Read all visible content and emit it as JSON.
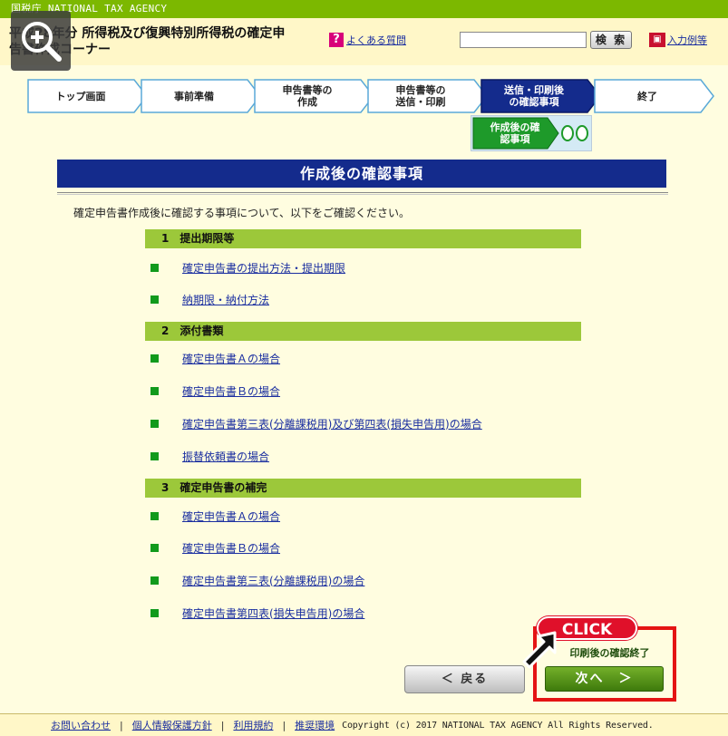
{
  "topbar": {
    "agency": "国税庁 NATIONAL TAX AGENCY"
  },
  "header": {
    "title_line1": "平成28年分 所得税及び復興特別所得税の確定申",
    "title_line2": "告書作成コーナー",
    "faq_icon": "?",
    "faq_label": "よくある質問",
    "search_value": "",
    "search_button": "検 索",
    "examples_icon": "book-icon",
    "examples_label": "入力例等"
  },
  "steps": [
    {
      "label": "トップ画面",
      "active": false
    },
    {
      "label": "事前準備",
      "active": false
    },
    {
      "label": "申告書等の\n作成",
      "active": false
    },
    {
      "label": "申告書等の\n送信・印刷",
      "active": false
    },
    {
      "label": "送信・印刷後\nの確認事項",
      "active": true
    },
    {
      "label": "終了",
      "active": false
    }
  ],
  "substep": {
    "label": "作成後の確\n認事項",
    "marker": "OO"
  },
  "page": {
    "title": "作成後の確認事項",
    "intro": "確定申告書作成後に確認する事項について、以下をご確認ください。"
  },
  "sections": [
    {
      "head": "1　提出期限等",
      "links": [
        "確定申告書の提出方法・提出期限",
        "納期限・納付方法"
      ]
    },
    {
      "head": "2　添付書類",
      "links": [
        "確定申告書Ａの場合",
        "確定申告書Ｂの場合",
        "確定申告書第三表(分離課税用)及び第四表(損失申告用)の場合",
        "振替依頼書の場合"
      ]
    },
    {
      "head": "3　確定申告書の補完",
      "links": [
        "確定申告書Ａの場合",
        "確定申告書Ｂの場合",
        "確定申告書第三表(分離課税用)の場合",
        "確定申告書第四表(損失申告用)の場合"
      ]
    }
  ],
  "nav": {
    "back_label": "＜ 戻る",
    "next_caption": "印刷後の確認終了",
    "next_label": "次へ　＞",
    "click_label": "CLICK"
  },
  "footer": {
    "links": [
      "お問い合わせ",
      "個人情報保護方針",
      "利用規約",
      "推奨環境"
    ],
    "copyright": "Copyright (c) 2017 NATIONAL TAX AGENCY All Rights Reserved."
  },
  "colors": {
    "active_step": "#142b8c",
    "step_arrow": "#ffffff",
    "step_border": "#5aa9d8",
    "section_head": "#9cc83a",
    "title_bar": "#142b8c",
    "next_button": "#4e8e14",
    "click_highlight": "#e41414"
  }
}
